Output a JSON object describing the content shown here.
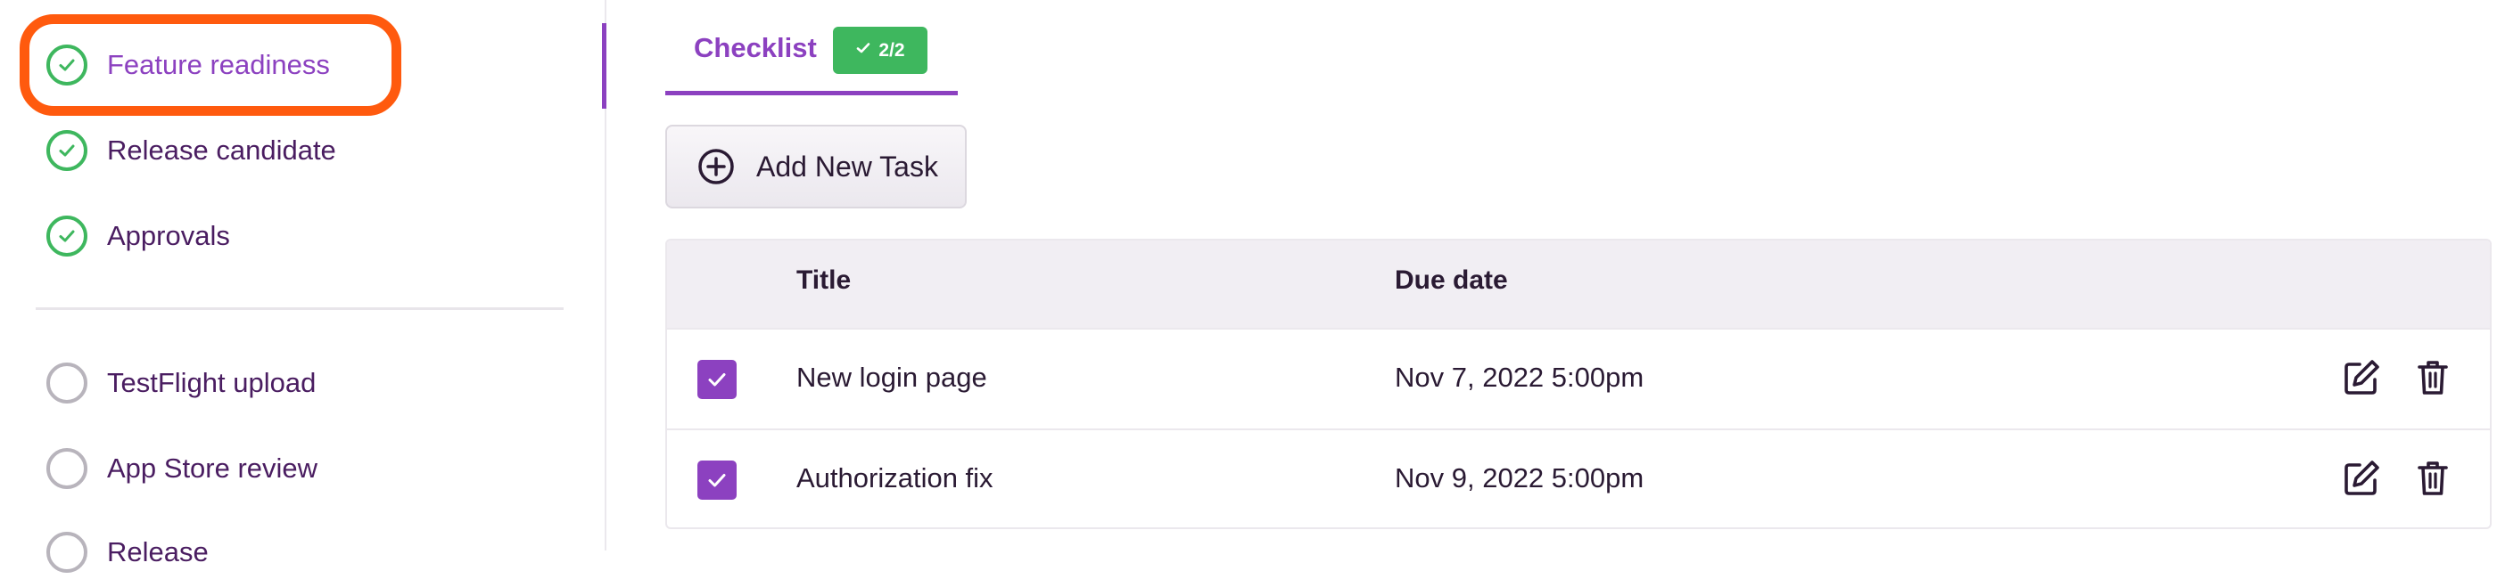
{
  "sidebar": {
    "items": [
      {
        "label": "Feature readiness",
        "status": "complete",
        "active": true
      },
      {
        "label": "Release candidate",
        "status": "complete",
        "active": false
      },
      {
        "label": "Approvals",
        "status": "complete",
        "active": false
      },
      {
        "label": "TestFlight upload",
        "status": "pending",
        "active": false
      },
      {
        "label": "App Store review",
        "status": "pending",
        "active": false
      },
      {
        "label": "Release",
        "status": "pending",
        "active": false
      }
    ]
  },
  "tabs": [
    {
      "label": "Checklist",
      "badge": "2/2",
      "badge_icon": "check-icon",
      "active": true
    }
  ],
  "toolbar": {
    "add_task_label": "Add New Task",
    "add_task_icon": "plus-circle-icon"
  },
  "table": {
    "columns": [
      "Title",
      "Due date"
    ],
    "rows": [
      {
        "checked": true,
        "title": "New login page",
        "due_date": "Nov 7, 2022 5:00pm"
      },
      {
        "checked": true,
        "title": "Authorization fix",
        "due_date": "Nov 9, 2022 5:00pm"
      }
    ],
    "row_actions": [
      "edit-icon",
      "trash-icon"
    ]
  },
  "colors": {
    "accent": "#8c41c0",
    "success": "#3eb75e",
    "highlight": "#ff5a0e",
    "text_dark": "#2a1a33",
    "sidebar_text": "#4a1d61"
  }
}
